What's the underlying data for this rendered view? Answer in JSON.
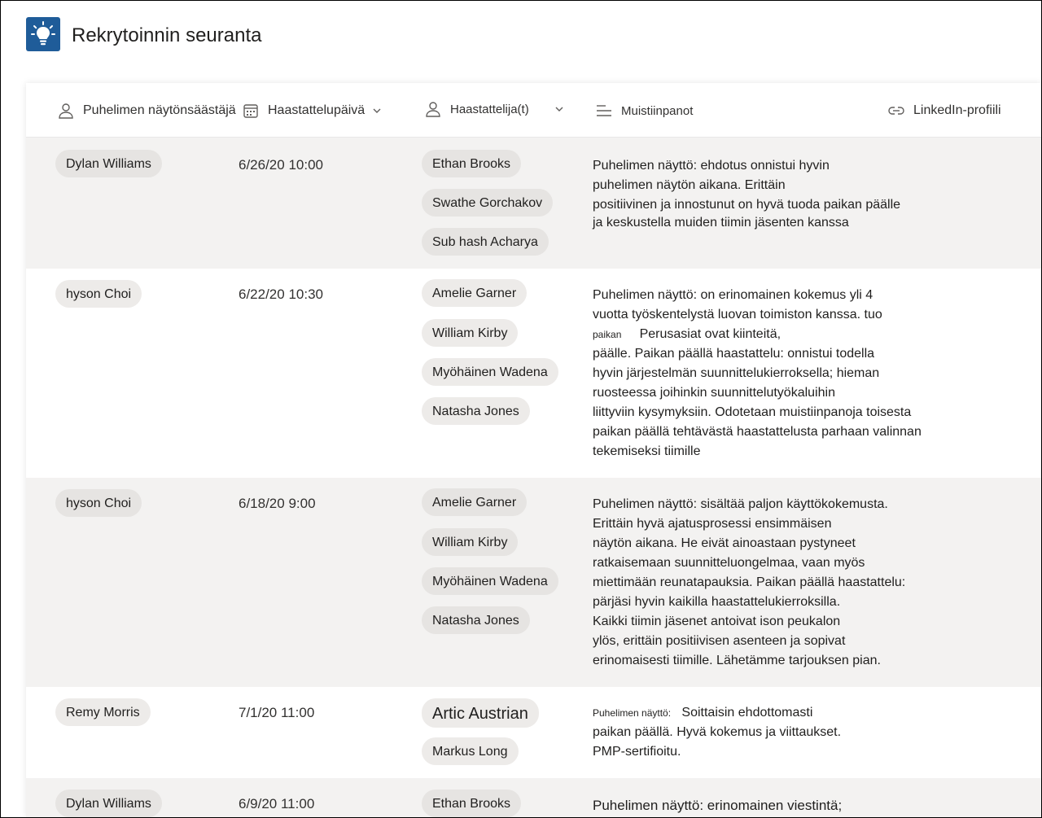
{
  "app": {
    "title": "Rekrytoinnin seuranta",
    "logo_icon": "lightbulb-icon",
    "accent": "#1f5c99"
  },
  "columns": [
    {
      "label": "Puhelimen näytönsäästäjä",
      "icon": "person-icon"
    },
    {
      "label": "Haastattelupäivä",
      "icon": "calendar-icon",
      "sortable": true
    },
    {
      "label": "Haastattelija(t)",
      "icon": "person-icon",
      "sortable": true
    },
    {
      "label": "Muistiinpanot",
      "icon": "text-lines-icon"
    },
    {
      "label": "LinkedIn-profiili",
      "icon": "link-icon"
    }
  ],
  "rows": [
    {
      "candidate": "Dylan Williams",
      "date": "6/26/20 10:00",
      "interviewers": [
        "Ethan  Brooks",
        "Swathe Gorchakov",
        "Sub hash Acharya"
      ],
      "notes": [
        "Puhelimen näyttö: ehdotus onnistui hyvin",
        "puhelimen näytön aikana. Erittäin",
        "positiivinen ja innostunut on hyvä tuoda paikan päälle",
        "ja keskustella muiden tiimin jäsenten kanssa"
      ]
    },
    {
      "candidate": "hyson Choi",
      "date": "6/22/20 10:30",
      "interviewers": [
        "Amelie Garner",
        "William Kirby",
        "Myöhäinen Wadena",
        "Natasha Jones"
      ],
      "notes_small_prefix": "paikan",
      "notes": [
        "Puhelimen näyttö: on erinomainen kokemus yli 4",
        "vuotta työskentelystä luovan toimiston kanssa. tuo",
        "Perusasiat ovat kiinteitä,",
        "päälle. Paikan päällä haastattelu: onnistui todella",
        "hyvin järjestelmän suunnittelukierroksella; hieman",
        "ruosteessa joihinkin suunnittelutyökaluihin",
        "liittyviin kysymyksiin. Odotetaan muistiinpanoja toisesta",
        "paikan päällä tehtävästä haastattelusta parhaan valinnan",
        "tekemiseksi tiimille"
      ]
    },
    {
      "candidate": "hyson Choi",
      "date": "6/18/20 9:00",
      "interviewers": [
        "Amelie Garner",
        "William Kirby",
        "Myöhäinen Wadena",
        "Natasha Jones"
      ],
      "notes": [
        "Puhelimen näyttö: sisältää paljon käyttökokemusta.",
        "Erittäin hyvä ajatusprosessi ensimmäisen",
        "näytön aikana. He eivät ainoastaan pystyneet",
        "ratkaisemaan suunnitteluongelmaa, vaan myös",
        "miettimään reunatapauksia. Paikan päällä haastattelu:",
        "pärjäsi hyvin kaikilla haastattelukierroksilla.",
        "Kaikki tiimin jäsenet antoivat ison peukalon",
        "ylös, erittäin positiivisen asenteen ja sopivat",
        "erinomaisesti tiimille. Lähetämme tarjouksen pian."
      ]
    },
    {
      "candidate": "Remy Morris",
      "date": "7/1/20 11:00",
      "interviewers": [
        "Artic Austrian",
        "Markus Long"
      ],
      "notes_small_prefix": "Puhelimen näyttö:",
      "notes": [
        "Soittaisin ehdottomasti",
        "paikan päällä. Hyvä kokemus ja viittaukset.",
        "PMP-sertifioitu."
      ]
    },
    {
      "candidate": "Dylan Williams",
      "date": "6/9/20 11:00",
      "interviewers": [
        "Ethan Brooks"
      ],
      "notes": [
        "Puhelimen näyttö: erinomainen viestintä;"
      ]
    }
  ]
}
